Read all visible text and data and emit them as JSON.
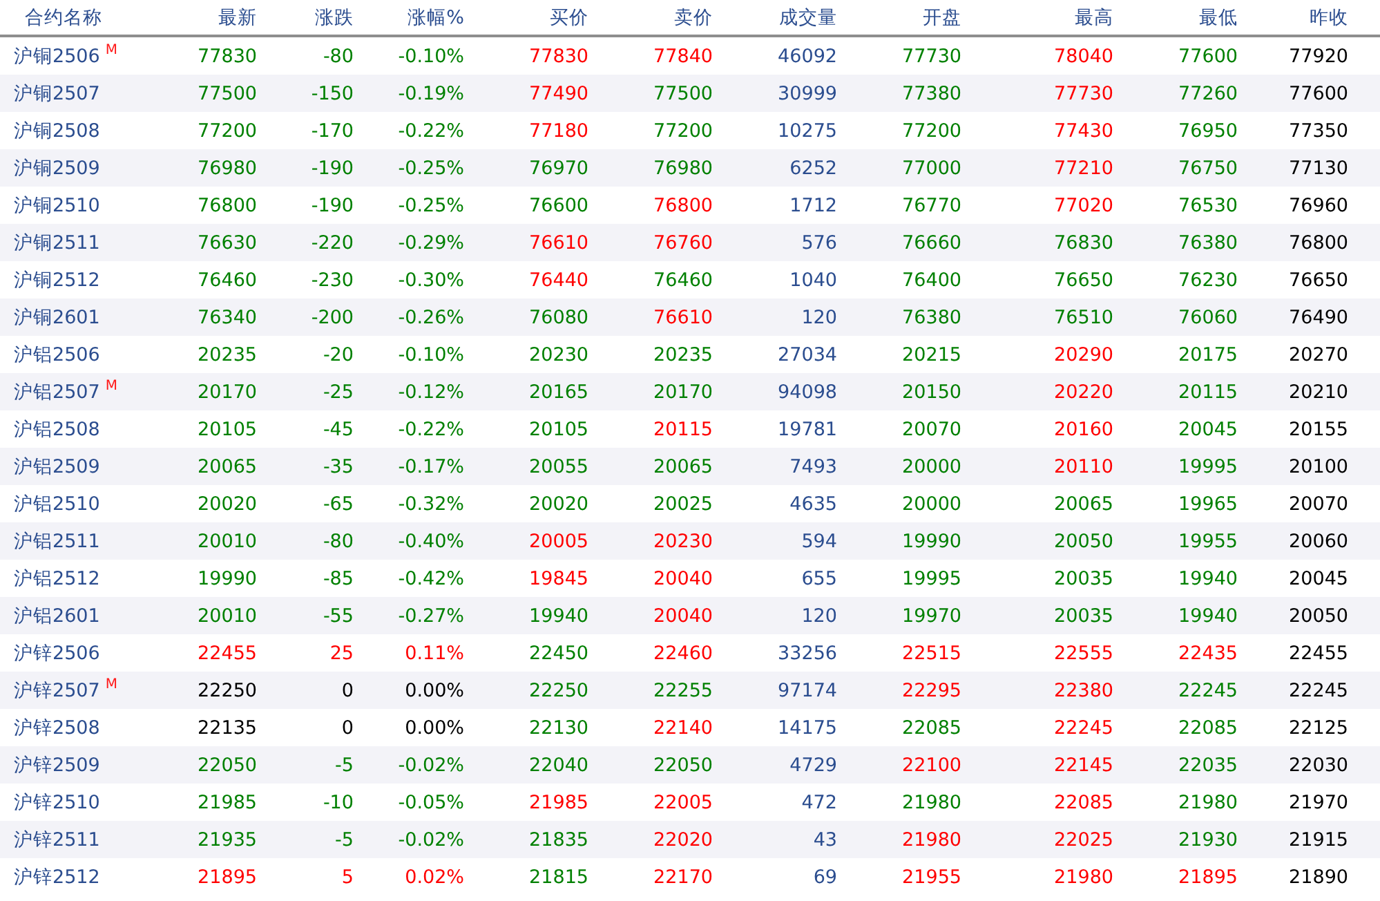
{
  "table": {
    "columns": [
      {
        "label": "合约名称",
        "kind": "name"
      },
      {
        "label": "最新",
        "kind": "quote"
      },
      {
        "label": "涨跌",
        "kind": "quote"
      },
      {
        "label": "涨幅%",
        "kind": "quote"
      },
      {
        "label": "买价",
        "kind": "quote"
      },
      {
        "label": "卖价",
        "kind": "quote"
      },
      {
        "label": "成交量",
        "kind": "volume"
      },
      {
        "label": "开盘",
        "kind": "quote"
      },
      {
        "label": "最高",
        "kind": "quote"
      },
      {
        "label": "最低",
        "kind": "quote"
      },
      {
        "label": "昨收",
        "kind": "reference"
      }
    ],
    "rows": [
      {
        "cells": [
          {
            "value": "沪铜2506",
            "badge": "M"
          },
          {
            "value": "77830",
            "color": "#008000"
          },
          {
            "value": "-80",
            "color": "#008000"
          },
          {
            "value": "-0.10%",
            "color": "#008000"
          },
          {
            "value": "77830",
            "color": "#ff0000"
          },
          {
            "value": "77840",
            "color": "#ff0000"
          },
          {
            "value": "46092"
          },
          {
            "value": "77730",
            "color": "#008000"
          },
          {
            "value": "78040",
            "color": "#ff0000"
          },
          {
            "value": "77600",
            "color": "#008000"
          },
          {
            "value": "77920"
          }
        ]
      },
      {
        "cells": [
          {
            "value": "沪铜2507"
          },
          {
            "value": "77500",
            "color": "#008000"
          },
          {
            "value": "-150",
            "color": "#008000"
          },
          {
            "value": "-0.19%",
            "color": "#008000"
          },
          {
            "value": "77490",
            "color": "#ff0000"
          },
          {
            "value": "77500",
            "color": "#008000"
          },
          {
            "value": "30999"
          },
          {
            "value": "77380",
            "color": "#008000"
          },
          {
            "value": "77730",
            "color": "#ff0000"
          },
          {
            "value": "77260",
            "color": "#008000"
          },
          {
            "value": "77600"
          }
        ]
      },
      {
        "cells": [
          {
            "value": "沪铜2508"
          },
          {
            "value": "77200",
            "color": "#008000"
          },
          {
            "value": "-170",
            "color": "#008000"
          },
          {
            "value": "-0.22%",
            "color": "#008000"
          },
          {
            "value": "77180",
            "color": "#ff0000"
          },
          {
            "value": "77200",
            "color": "#008000"
          },
          {
            "value": "10275"
          },
          {
            "value": "77200",
            "color": "#008000"
          },
          {
            "value": "77430",
            "color": "#ff0000"
          },
          {
            "value": "76950",
            "color": "#008000"
          },
          {
            "value": "77350"
          }
        ]
      },
      {
        "cells": [
          {
            "value": "沪铜2509"
          },
          {
            "value": "76980",
            "color": "#008000"
          },
          {
            "value": "-190",
            "color": "#008000"
          },
          {
            "value": "-0.25%",
            "color": "#008000"
          },
          {
            "value": "76970",
            "color": "#008000"
          },
          {
            "value": "76980",
            "color": "#008000"
          },
          {
            "value": "6252"
          },
          {
            "value": "77000",
            "color": "#008000"
          },
          {
            "value": "77210",
            "color": "#ff0000"
          },
          {
            "value": "76750",
            "color": "#008000"
          },
          {
            "value": "77130"
          }
        ]
      },
      {
        "cells": [
          {
            "value": "沪铜2510"
          },
          {
            "value": "76800",
            "color": "#008000"
          },
          {
            "value": "-190",
            "color": "#008000"
          },
          {
            "value": "-0.25%",
            "color": "#008000"
          },
          {
            "value": "76600",
            "color": "#008000"
          },
          {
            "value": "76800",
            "color": "#ff0000"
          },
          {
            "value": "1712"
          },
          {
            "value": "76770",
            "color": "#008000"
          },
          {
            "value": "77020",
            "color": "#ff0000"
          },
          {
            "value": "76530",
            "color": "#008000"
          },
          {
            "value": "76960"
          }
        ]
      },
      {
        "cells": [
          {
            "value": "沪铜2511"
          },
          {
            "value": "76630",
            "color": "#008000"
          },
          {
            "value": "-220",
            "color": "#008000"
          },
          {
            "value": "-0.29%",
            "color": "#008000"
          },
          {
            "value": "76610",
            "color": "#ff0000"
          },
          {
            "value": "76760",
            "color": "#ff0000"
          },
          {
            "value": "576"
          },
          {
            "value": "76660",
            "color": "#008000"
          },
          {
            "value": "76830",
            "color": "#008000"
          },
          {
            "value": "76380",
            "color": "#008000"
          },
          {
            "value": "76800"
          }
        ]
      },
      {
        "cells": [
          {
            "value": "沪铜2512"
          },
          {
            "value": "76460",
            "color": "#008000"
          },
          {
            "value": "-230",
            "color": "#008000"
          },
          {
            "value": "-0.30%",
            "color": "#008000"
          },
          {
            "value": "76440",
            "color": "#ff0000"
          },
          {
            "value": "76460",
            "color": "#008000"
          },
          {
            "value": "1040"
          },
          {
            "value": "76400",
            "color": "#008000"
          },
          {
            "value": "76650",
            "color": "#008000"
          },
          {
            "value": "76230",
            "color": "#008000"
          },
          {
            "value": "76650"
          }
        ]
      },
      {
        "cells": [
          {
            "value": "沪铜2601"
          },
          {
            "value": "76340",
            "color": "#008000"
          },
          {
            "value": "-200",
            "color": "#008000"
          },
          {
            "value": "-0.26%",
            "color": "#008000"
          },
          {
            "value": "76080",
            "color": "#008000"
          },
          {
            "value": "76610",
            "color": "#ff0000"
          },
          {
            "value": "120"
          },
          {
            "value": "76380",
            "color": "#008000"
          },
          {
            "value": "76510",
            "color": "#008000"
          },
          {
            "value": "76060",
            "color": "#008000"
          },
          {
            "value": "76490"
          }
        ]
      },
      {
        "cells": [
          {
            "value": "沪铝2506"
          },
          {
            "value": "20235",
            "color": "#008000"
          },
          {
            "value": "-20",
            "color": "#008000"
          },
          {
            "value": "-0.10%",
            "color": "#008000"
          },
          {
            "value": "20230",
            "color": "#008000"
          },
          {
            "value": "20235",
            "color": "#008000"
          },
          {
            "value": "27034"
          },
          {
            "value": "20215",
            "color": "#008000"
          },
          {
            "value": "20290",
            "color": "#ff0000"
          },
          {
            "value": "20175",
            "color": "#008000"
          },
          {
            "value": "20270"
          }
        ]
      },
      {
        "cells": [
          {
            "value": "沪铝2507",
            "badge": "M"
          },
          {
            "value": "20170",
            "color": "#008000"
          },
          {
            "value": "-25",
            "color": "#008000"
          },
          {
            "value": "-0.12%",
            "color": "#008000"
          },
          {
            "value": "20165",
            "color": "#008000"
          },
          {
            "value": "20170",
            "color": "#008000"
          },
          {
            "value": "94098"
          },
          {
            "value": "20150",
            "color": "#008000"
          },
          {
            "value": "20220",
            "color": "#ff0000"
          },
          {
            "value": "20115",
            "color": "#008000"
          },
          {
            "value": "20210"
          }
        ]
      },
      {
        "cells": [
          {
            "value": "沪铝2508"
          },
          {
            "value": "20105",
            "color": "#008000"
          },
          {
            "value": "-45",
            "color": "#008000"
          },
          {
            "value": "-0.22%",
            "color": "#008000"
          },
          {
            "value": "20105",
            "color": "#008000"
          },
          {
            "value": "20115",
            "color": "#ff0000"
          },
          {
            "value": "19781"
          },
          {
            "value": "20070",
            "color": "#008000"
          },
          {
            "value": "20160",
            "color": "#ff0000"
          },
          {
            "value": "20045",
            "color": "#008000"
          },
          {
            "value": "20155"
          }
        ]
      },
      {
        "cells": [
          {
            "value": "沪铝2509"
          },
          {
            "value": "20065",
            "color": "#008000"
          },
          {
            "value": "-35",
            "color": "#008000"
          },
          {
            "value": "-0.17%",
            "color": "#008000"
          },
          {
            "value": "20055",
            "color": "#008000"
          },
          {
            "value": "20065",
            "color": "#008000"
          },
          {
            "value": "7493"
          },
          {
            "value": "20000",
            "color": "#008000"
          },
          {
            "value": "20110",
            "color": "#ff0000"
          },
          {
            "value": "19995",
            "color": "#008000"
          },
          {
            "value": "20100"
          }
        ]
      },
      {
        "cells": [
          {
            "value": "沪铝2510"
          },
          {
            "value": "20020",
            "color": "#008000"
          },
          {
            "value": "-65",
            "color": "#008000"
          },
          {
            "value": "-0.32%",
            "color": "#008000"
          },
          {
            "value": "20020",
            "color": "#008000"
          },
          {
            "value": "20025",
            "color": "#008000"
          },
          {
            "value": "4635"
          },
          {
            "value": "20000",
            "color": "#008000"
          },
          {
            "value": "20065",
            "color": "#008000"
          },
          {
            "value": "19965",
            "color": "#008000"
          },
          {
            "value": "20070"
          }
        ]
      },
      {
        "cells": [
          {
            "value": "沪铝2511"
          },
          {
            "value": "20010",
            "color": "#008000"
          },
          {
            "value": "-80",
            "color": "#008000"
          },
          {
            "value": "-0.40%",
            "color": "#008000"
          },
          {
            "value": "20005",
            "color": "#ff0000"
          },
          {
            "value": "20230",
            "color": "#ff0000"
          },
          {
            "value": "594"
          },
          {
            "value": "19990",
            "color": "#008000"
          },
          {
            "value": "20050",
            "color": "#008000"
          },
          {
            "value": "19955",
            "color": "#008000"
          },
          {
            "value": "20060"
          }
        ]
      },
      {
        "cells": [
          {
            "value": "沪铝2512"
          },
          {
            "value": "19990",
            "color": "#008000"
          },
          {
            "value": "-85",
            "color": "#008000"
          },
          {
            "value": "-0.42%",
            "color": "#008000"
          },
          {
            "value": "19845",
            "color": "#ff0000"
          },
          {
            "value": "20040",
            "color": "#ff0000"
          },
          {
            "value": "655"
          },
          {
            "value": "19995",
            "color": "#008000"
          },
          {
            "value": "20035",
            "color": "#008000"
          },
          {
            "value": "19940",
            "color": "#008000"
          },
          {
            "value": "20045"
          }
        ]
      },
      {
        "cells": [
          {
            "value": "沪铝2601"
          },
          {
            "value": "20010",
            "color": "#008000"
          },
          {
            "value": "-55",
            "color": "#008000"
          },
          {
            "value": "-0.27%",
            "color": "#008000"
          },
          {
            "value": "19940",
            "color": "#008000"
          },
          {
            "value": "20040",
            "color": "#ff0000"
          },
          {
            "value": "120"
          },
          {
            "value": "19970",
            "color": "#008000"
          },
          {
            "value": "20035",
            "color": "#008000"
          },
          {
            "value": "19940",
            "color": "#008000"
          },
          {
            "value": "20050"
          }
        ]
      },
      {
        "cells": [
          {
            "value": "沪锌2506"
          },
          {
            "value": "22455",
            "color": "#ff0000"
          },
          {
            "value": "25",
            "color": "#ff0000"
          },
          {
            "value": "0.11%",
            "color": "#ff0000"
          },
          {
            "value": "22450",
            "color": "#008000"
          },
          {
            "value": "22460",
            "color": "#ff0000"
          },
          {
            "value": "33256"
          },
          {
            "value": "22515",
            "color": "#ff0000"
          },
          {
            "value": "22555",
            "color": "#ff0000"
          },
          {
            "value": "22435",
            "color": "#ff0000"
          },
          {
            "value": "22455"
          }
        ]
      },
      {
        "cells": [
          {
            "value": "沪锌2507",
            "badge": "M"
          },
          {
            "value": "22250",
            "color": "#000000"
          },
          {
            "value": "0",
            "color": "#000000"
          },
          {
            "value": "0.00%",
            "color": "#000000"
          },
          {
            "value": "22250",
            "color": "#008000"
          },
          {
            "value": "22255",
            "color": "#008000"
          },
          {
            "value": "97174"
          },
          {
            "value": "22295",
            "color": "#ff0000"
          },
          {
            "value": "22380",
            "color": "#ff0000"
          },
          {
            "value": "22245",
            "color": "#008000"
          },
          {
            "value": "22245"
          }
        ]
      },
      {
        "cells": [
          {
            "value": "沪锌2508"
          },
          {
            "value": "22135",
            "color": "#000000"
          },
          {
            "value": "0",
            "color": "#000000"
          },
          {
            "value": "0.00%",
            "color": "#000000"
          },
          {
            "value": "22130",
            "color": "#008000"
          },
          {
            "value": "22140",
            "color": "#ff0000"
          },
          {
            "value": "14175"
          },
          {
            "value": "22085",
            "color": "#008000"
          },
          {
            "value": "22245",
            "color": "#ff0000"
          },
          {
            "value": "22085",
            "color": "#008000"
          },
          {
            "value": "22125"
          }
        ]
      },
      {
        "cells": [
          {
            "value": "沪锌2509"
          },
          {
            "value": "22050",
            "color": "#008000"
          },
          {
            "value": "-5",
            "color": "#008000"
          },
          {
            "value": "-0.02%",
            "color": "#008000"
          },
          {
            "value": "22040",
            "color": "#008000"
          },
          {
            "value": "22050",
            "color": "#008000"
          },
          {
            "value": "4729"
          },
          {
            "value": "22100",
            "color": "#ff0000"
          },
          {
            "value": "22145",
            "color": "#ff0000"
          },
          {
            "value": "22035",
            "color": "#008000"
          },
          {
            "value": "22030"
          }
        ]
      },
      {
        "cells": [
          {
            "value": "沪锌2510"
          },
          {
            "value": "21985",
            "color": "#008000"
          },
          {
            "value": "-10",
            "color": "#008000"
          },
          {
            "value": "-0.05%",
            "color": "#008000"
          },
          {
            "value": "21985",
            "color": "#ff0000"
          },
          {
            "value": "22005",
            "color": "#ff0000"
          },
          {
            "value": "472"
          },
          {
            "value": "21980",
            "color": "#008000"
          },
          {
            "value": "22085",
            "color": "#ff0000"
          },
          {
            "value": "21980",
            "color": "#008000"
          },
          {
            "value": "21970"
          }
        ]
      },
      {
        "cells": [
          {
            "value": "沪锌2511"
          },
          {
            "value": "21935",
            "color": "#008000"
          },
          {
            "value": "-5",
            "color": "#008000"
          },
          {
            "value": "-0.02%",
            "color": "#008000"
          },
          {
            "value": "21835",
            "color": "#008000"
          },
          {
            "value": "22020",
            "color": "#ff0000"
          },
          {
            "value": "43"
          },
          {
            "value": "21980",
            "color": "#ff0000"
          },
          {
            "value": "22025",
            "color": "#ff0000"
          },
          {
            "value": "21930",
            "color": "#008000"
          },
          {
            "value": "21915"
          }
        ]
      },
      {
        "cells": [
          {
            "value": "沪锌2512"
          },
          {
            "value": "21895",
            "color": "#ff0000"
          },
          {
            "value": "5",
            "color": "#ff0000"
          },
          {
            "value": "0.02%",
            "color": "#ff0000"
          },
          {
            "value": "21815",
            "color": "#008000"
          },
          {
            "value": "22170",
            "color": "#ff0000"
          },
          {
            "value": "69"
          },
          {
            "value": "21955",
            "color": "#ff0000"
          },
          {
            "value": "21980",
            "color": "#ff0000"
          },
          {
            "value": "21895",
            "color": "#ff0000"
          },
          {
            "value": "21890"
          }
        ]
      }
    ]
  }
}
